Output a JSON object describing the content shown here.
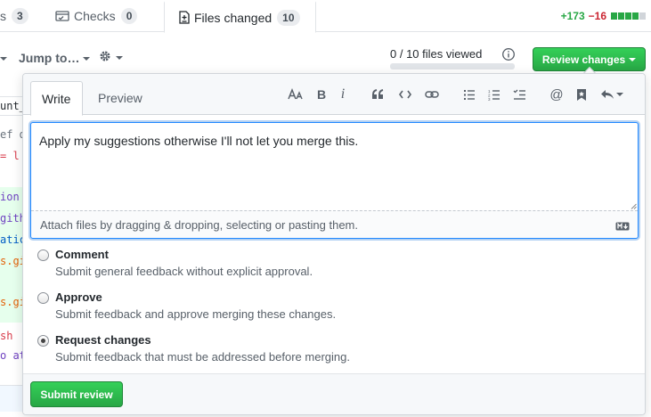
{
  "tabs": {
    "conversation": {
      "label": "s",
      "count": "3"
    },
    "checks": {
      "label": "Checks",
      "count": "0"
    },
    "files": {
      "label": "Files changed",
      "count": "10"
    }
  },
  "diffstat": {
    "additions": "+173",
    "deletions": "−16"
  },
  "toolbar": {
    "jump_label": "Jump to…",
    "viewed_label": "0 / 10 files viewed",
    "review_button_label": "Review changes"
  },
  "code_fragments": [
    "unt_",
    "ef d",
    "= l",
    "ion",
    "gith",
    "atic",
    "s.gi",
    "s.gi",
    "sh",
    "o at"
  ],
  "review": {
    "tabs": {
      "write": "Write",
      "preview": "Preview"
    },
    "toolbar_icons": [
      "text-size-icon",
      "bold-icon",
      "italic-icon",
      "quote-icon",
      "code-icon",
      "link-icon",
      "bulleted-list-icon",
      "numbered-list-icon",
      "task-list-icon",
      "mention-icon",
      "saved-reply-icon",
      "reply-icon"
    ],
    "comment_text": "Apply my suggestions otherwise I'll not let you merge this.",
    "attach_hint": "Attach files by dragging & dropping, selecting or pasting them.",
    "options": [
      {
        "title": "Comment",
        "description": "Submit general feedback without explicit approval.",
        "selected": false
      },
      {
        "title": "Approve",
        "description": "Submit feedback and approve merging these changes.",
        "selected": false
      },
      {
        "title": "Request changes",
        "description": "Submit feedback that must be addressed before merging.",
        "selected": true
      }
    ],
    "submit_label": "Submit review"
  },
  "colors": {
    "accent_green": "#2ea44f",
    "focus_blue": "#2188ff",
    "additions": "#28a745",
    "deletions": "#cb2431"
  }
}
